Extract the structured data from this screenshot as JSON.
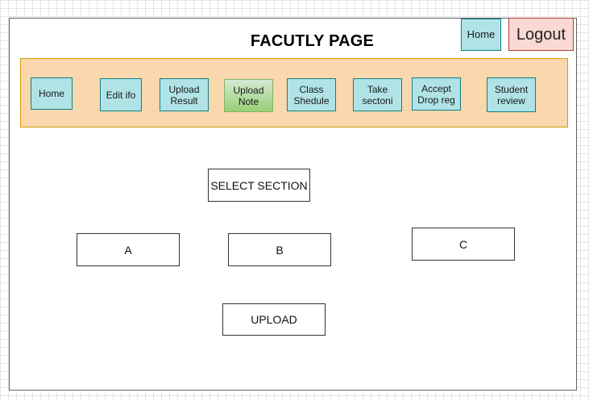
{
  "page": {
    "title": "FACUTLY PAGE"
  },
  "header": {
    "home_label": "Home",
    "logout_label": "Logout"
  },
  "nav": {
    "items": [
      {
        "label": "Home"
      },
      {
        "label": "Edit ifo"
      },
      {
        "label": "Upload\nResult"
      },
      {
        "label": "Upload\nNote"
      },
      {
        "label": "Class\nShedule"
      },
      {
        "label": "Take\nsectoni"
      },
      {
        "label": "Accept\nDrop reg"
      },
      {
        "label": "Student\nreview"
      }
    ]
  },
  "main": {
    "select_section_label": "SELECT SECTION",
    "sections": [
      {
        "label": "A"
      },
      {
        "label": "B"
      },
      {
        "label": "C"
      }
    ],
    "upload_label": "UPLOAD"
  },
  "colors": {
    "nav_background": "#fad7ac",
    "nav_border": "#d79b00",
    "button_fill": "#b0e3e6",
    "button_border": "#0e8088",
    "active_fill": "#97d077",
    "logout_fill": "#fad9d5"
  }
}
